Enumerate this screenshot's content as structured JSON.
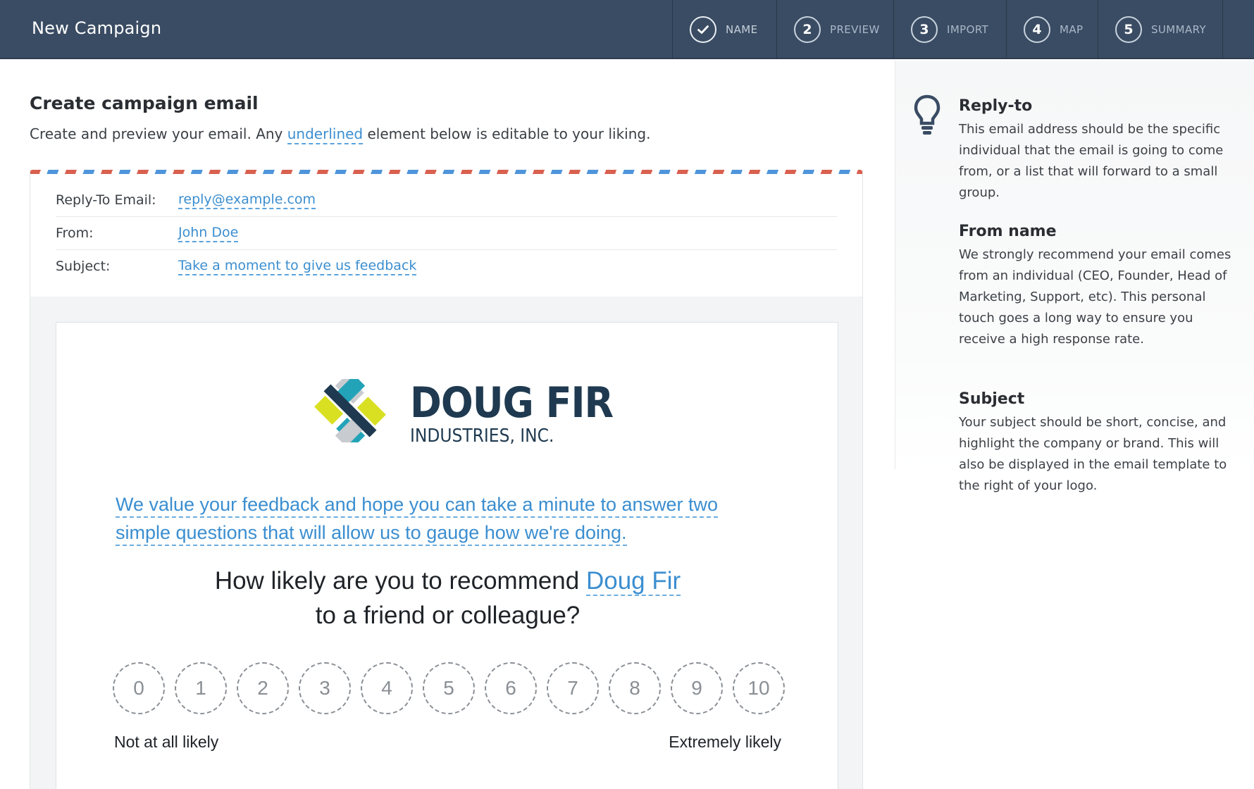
{
  "app": {
    "title": "New Campaign"
  },
  "steps": [
    {
      "number": "✓",
      "label": "NAME",
      "state": "done"
    },
    {
      "number": "2",
      "label": "PREVIEW",
      "state": "current"
    },
    {
      "number": "3",
      "label": "IMPORT",
      "state": "upcoming"
    },
    {
      "number": "4",
      "label": "MAP",
      "state": "upcoming"
    },
    {
      "number": "5",
      "label": "SUMMARY",
      "state": "upcoming"
    }
  ],
  "main": {
    "title": "Create campaign email",
    "desc_before": "Create and preview your email. Any ",
    "desc_link": "underlined",
    "desc_after": " element below is editable to your liking."
  },
  "email_header": {
    "reply_to_label": "Reply-To Email:",
    "reply_to_value": "reply@example.com",
    "from_label": "From:",
    "from_value": "John Doe",
    "subject_label": "Subject:",
    "subject_value": "Take a moment to give us feedback"
  },
  "email_body": {
    "logo_name": "DOUG FIR",
    "logo_sub": "INDUSTRIES, INC.",
    "intro": "We value your feedback and hope you can take a minute to answer two simple questions that will allow us to gauge how we're doing.",
    "question_before": "How likely are you to recommend ",
    "question_brand": "Doug Fir",
    "question_after": "to a friend or colleague?",
    "scale": [
      "0",
      "1",
      "2",
      "3",
      "4",
      "5",
      "6",
      "7",
      "8",
      "9",
      "10"
    ],
    "scale_low_label": "Not at all likely",
    "scale_high_label": "Extremely likely"
  },
  "tips": [
    {
      "title": "Reply-to",
      "body": "This email address should be the specific individual that the email is going to come from, or a list that will forward to a small group."
    },
    {
      "title": "From name",
      "body": "We strongly recommend your email comes from an individual (CEO, Founder, Head of Marketing, Support, etc). This personal touch goes a long way to ensure you receive a high response rate."
    },
    {
      "title": "Subject",
      "body": "Your subject should be short, concise, and highlight the company or brand. This will also be displayed in the email template to the right of your logo."
    }
  ],
  "colors": {
    "topbar": "#3a4c63",
    "link_blue": "#3b8ed0",
    "brand_navy": "#1f3a50",
    "logo_teal": "#23a3b8",
    "logo_lime": "#d9e021",
    "logo_gray": "#c8cbcf",
    "airmail_red": "#d9604f",
    "airmail_blue": "#4e95db"
  },
  "icons": {
    "step_done": "check-icon",
    "tips": "lightbulb-icon"
  }
}
